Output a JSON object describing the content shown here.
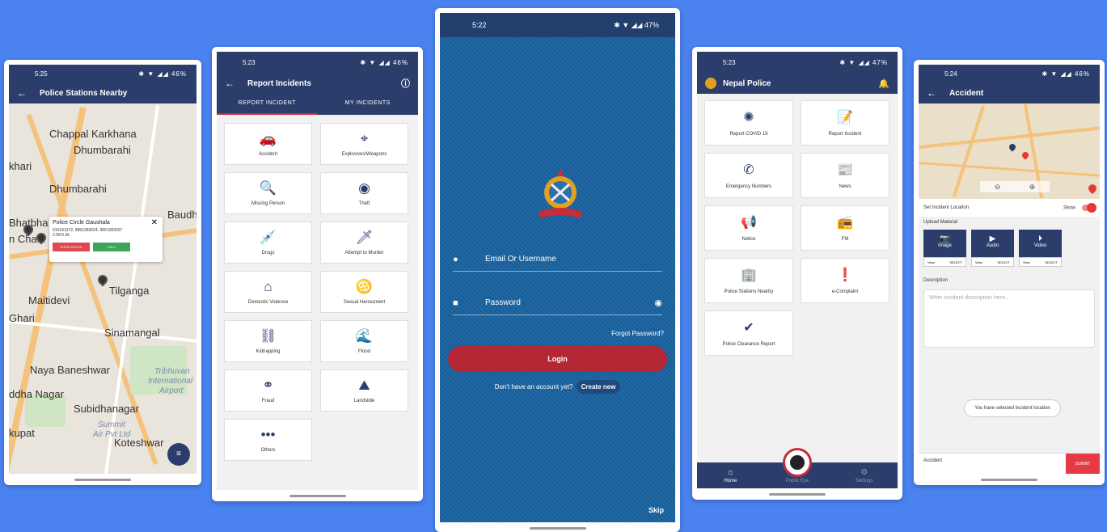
{
  "colors": {
    "background": "#4a82f0",
    "primary": "#2b3e6b",
    "accent": "#c62d3a"
  },
  "screen1": {
    "time": "5:25",
    "status_icons": "✱ ▼ ◢◢ 46%",
    "title": "Police Stations Nearby",
    "map_labels": [
      "Chappal Karkhana",
      "Dhumbarahi",
      "khari",
      "Dhumbarahi",
      "Bhatbha",
      "n Chaur",
      "Baudh",
      "Maitidevi",
      "Tilganga",
      "Ghari",
      "Sinamangal",
      "Naya Baneshwar",
      "Tribhuvan",
      "International",
      "Airport",
      "ddha Nagar",
      "Subidhanagar",
      "Summit",
      "Air Pvt Ltd",
      "kupat",
      "Koteshwar"
    ],
    "popup": {
      "title": "Police Circle Gaushala",
      "phones": "015241372, 9851283024, 9851283327",
      "distance": "2.58 K.M.",
      "route_btn": "SHOW ROUTE",
      "call_btn": "CALL"
    }
  },
  "screen2": {
    "time": "5:23",
    "status_icons": "✱ ▼ ◢◢ 46%",
    "title": "Report Incidents",
    "tabs": [
      "REPORT INCIDENT",
      "MY INCIDENTS"
    ],
    "items": [
      {
        "label": "Accident",
        "icon": "🚗"
      },
      {
        "label": "Explosives/Weapons",
        "icon": "⌖"
      },
      {
        "label": "Missing Person",
        "icon": "🔍"
      },
      {
        "label": "Theft",
        "icon": "◉"
      },
      {
        "label": "Drugs",
        "icon": "💉"
      },
      {
        "label": "Attempt to Murder",
        "icon": "🗡"
      },
      {
        "label": "Domestic Violence",
        "icon": "⌂"
      },
      {
        "label": "Sexual Harrasment",
        "icon": "♋"
      },
      {
        "label": "Kidnapping",
        "icon": "⛓"
      },
      {
        "label": "Flood",
        "icon": "🌊"
      },
      {
        "label": "Fraud",
        "icon": "⚭"
      },
      {
        "label": "Landslide",
        "icon": "⛰"
      },
      {
        "label": "Others",
        "icon": "•••"
      }
    ]
  },
  "screen3": {
    "time": "5:22",
    "status_icons": "✱ ▼ ◢◢ 47%",
    "email_placeholder": "Email Or Username",
    "password_placeholder": "Password",
    "forgot": "Forgot Password?",
    "login": "Login",
    "no_account": "Don't have an account yet?",
    "create_new": "Create new",
    "skip": "Skip"
  },
  "screen4": {
    "time": "5:23",
    "status_icons": "✱ ▼ ◢◢ 47%",
    "title": "Nepal Police",
    "items": [
      {
        "label": "Report COVID 19",
        "icon": "✺"
      },
      {
        "label": "Report Incident",
        "icon": "📝"
      },
      {
        "label": "Emergency Numbers",
        "icon": "✆"
      },
      {
        "label": "News",
        "icon": "📰"
      },
      {
        "label": "Notice",
        "icon": "📢"
      },
      {
        "label": "FM",
        "icon": "📻"
      },
      {
        "label": "Police Stations Nearby",
        "icon": "🏢"
      },
      {
        "label": "e-Complaint",
        "icon": "❗"
      },
      {
        "label": "Police Clearance Report",
        "icon": "✔"
      }
    ],
    "nav": [
      "Home",
      "Public Eye",
      "Settings"
    ]
  },
  "screen5": {
    "time": "5:24",
    "status_icons": "✱ ▼ ◢◢ 46%",
    "title": "Accident",
    "set_location": "Set Incident Location",
    "show": "Show",
    "upload": "Upload Material",
    "media": [
      {
        "label": "Image",
        "icon": "📷",
        "view": "View",
        "select": "SELECT"
      },
      {
        "label": "Audio",
        "icon": "▶",
        "view": "View",
        "select": "SELECT"
      },
      {
        "label": "Video",
        "icon": "⏵",
        "view": "View",
        "select": "SELECT"
      }
    ],
    "description": "Description",
    "desc_placeholder": "Write incident description here...",
    "toast": "You have selected incident location",
    "selected": "Accident",
    "submit": "SUBMIT"
  }
}
